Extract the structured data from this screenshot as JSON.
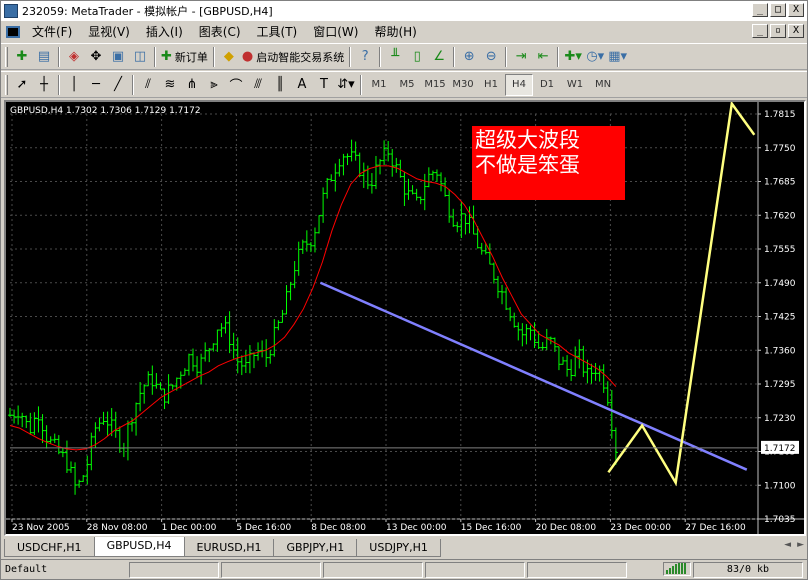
{
  "window": {
    "title": "232059: MetaTrader - 模拟帐户 - [GBPUSD,H4]",
    "btn_minimize": "_",
    "btn_maximize": "□",
    "btn_close": "X",
    "mdi_minimize": "_",
    "mdi_restore": "▫",
    "mdi_close": "X"
  },
  "menu": {
    "items": [
      "文件(F)",
      "显视(V)",
      "插入(I)",
      "图表(C)",
      "工具(T)",
      "窗口(W)",
      "帮助(H)"
    ]
  },
  "toolbar": {
    "new_order_label": "新订单",
    "expert_label": "启动智能交易系统"
  },
  "timeframes": [
    "M1",
    "M5",
    "M15",
    "M30",
    "H1",
    "H4",
    "D1",
    "W1",
    "MN"
  ],
  "active_timeframe": "H4",
  "chart_header": "GBPUSD,H4  1.7302 1.7306 1.7129 1.7172",
  "current_price": "1.7172",
  "annotation": {
    "line1": "超级大波段",
    "line2": "不做是笨蛋",
    "bg_color": "#ff0000"
  },
  "tabs": [
    "USDCHF,H1",
    "GBPUSD,H4",
    "EURUSD,H1",
    "GBPJPY,H1",
    "USDJPY,H1"
  ],
  "active_tab": "GBPUSD,H4",
  "tab_nav_left": "◄",
  "tab_nav_right": "►",
  "status": {
    "profile": "Default",
    "traffic": "83/0 kb"
  },
  "colors": {
    "bg": "#000000",
    "candles": "#00ff00",
    "ma": "#ff0000",
    "trendline": "#8080ff",
    "arrows": "#ffff80",
    "grid": "#4a4a4a"
  },
  "chart_data": {
    "type": "line",
    "symbol": "GBPUSD",
    "timeframe": "H4",
    "ylim": [
      1.7035,
      1.7815
    ],
    "y_ticks": [
      "1.7815",
      "1.7750",
      "1.7685",
      "1.7620",
      "1.7555",
      "1.7490",
      "1.7425",
      "1.7360",
      "1.7295",
      "1.7230",
      "1.7165",
      "1.7100",
      "1.7035"
    ],
    "x_ticks": [
      "23 Nov 2005",
      "28 Nov 08:00",
      "1 Dec 00:00",
      "5 Dec 16:00",
      "8 Dec 08:00",
      "13 Dec 00:00",
      "15 Dec 16:00",
      "20 Dec 08:00",
      "23 Dec 00:00",
      "27 Dec 16:00"
    ],
    "close_path": [
      1.7235,
      1.7248,
      1.7205,
      1.7242,
      1.7188,
      1.7165,
      1.7145,
      1.709,
      1.713,
      1.721,
      1.7235,
      1.72,
      1.718,
      1.7245,
      1.729,
      1.7305,
      1.727,
      1.7285,
      1.732,
      1.735,
      1.733,
      1.7365,
      1.741,
      1.7395,
      1.734,
      1.7325,
      1.736,
      1.7345,
      1.739,
      1.744,
      1.752,
      1.756,
      1.758,
      1.765,
      1.77,
      1.774,
      1.773,
      1.771,
      1.768,
      1.772,
      1.7745,
      1.77,
      1.766,
      1.764,
      1.769,
      1.771,
      1.765,
      1.761,
      1.762,
      1.758,
      1.754,
      1.751,
      1.747,
      1.743,
      1.739,
      1.74,
      1.736,
      1.738,
      1.734,
      1.732,
      1.735,
      1.731,
      1.733,
      1.729,
      1.7172
    ],
    "ma_path": [
      1.7215,
      1.721,
      1.72,
      1.719,
      1.7182,
      1.7175,
      1.717,
      1.7168,
      1.717,
      1.7178,
      1.719,
      1.7205,
      1.7215,
      1.7225,
      1.724,
      1.7255,
      1.727,
      1.728,
      1.729,
      1.73,
      1.731,
      1.7318,
      1.733,
      1.7338,
      1.7345,
      1.735,
      1.7355,
      1.736,
      1.737,
      1.7385,
      1.741,
      1.744,
      1.748,
      1.753,
      1.759,
      1.764,
      1.768,
      1.77,
      1.771,
      1.7715,
      1.7715,
      1.771,
      1.77,
      1.769,
      1.7685,
      1.7682,
      1.7675,
      1.766,
      1.764,
      1.761,
      1.7575,
      1.754,
      1.75,
      1.7465,
      1.743,
      1.741,
      1.739,
      1.738,
      1.737,
      1.7355,
      1.7345,
      1.7335,
      1.7325,
      1.731,
      1.729
    ],
    "trendline": [
      [
        0.415,
        1.749
      ],
      [
        0.985,
        1.713
      ]
    ],
    "forecast_arrow": [
      [
        0.8,
        1.7125
      ],
      [
        0.845,
        1.7215
      ],
      [
        0.89,
        1.7105
      ],
      [
        0.965,
        1.7835
      ],
      [
        0.995,
        1.7775
      ]
    ]
  }
}
